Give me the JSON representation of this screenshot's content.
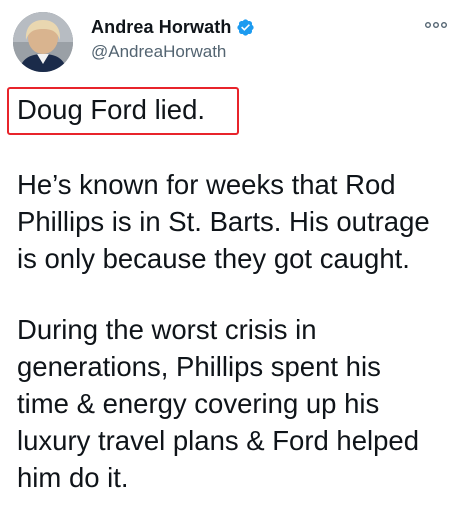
{
  "author": {
    "display_name": "Andrea Horwath",
    "handle": "@AndreaHorwath",
    "avatar_icon": "profile-photo",
    "verified_icon": "verified-badge-icon"
  },
  "menu": {
    "more_icon": "more-options-icon"
  },
  "tweet": {
    "paragraph_1": [
      "Doug Ford lied."
    ],
    "paragraph_2": [
      "He’s known for weeks that Rod",
      "Phillips is in St. Barts. His outrage",
      "is only because they got caught."
    ],
    "paragraph_3": [
      "During the worst crisis in",
      "generations, Phillips spent his",
      "time & energy covering up his",
      "luxury travel plans & Ford helped",
      "him do it."
    ]
  },
  "colors": {
    "verified_blue": "#1d9bf0",
    "highlight_red": "#e8242b",
    "text": "#0f1419",
    "secondary_text": "#536471"
  }
}
